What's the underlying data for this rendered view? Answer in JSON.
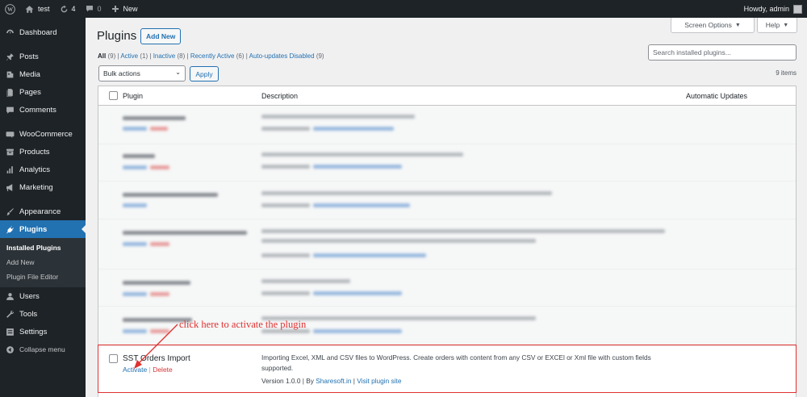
{
  "admin_bar": {
    "site_name": "test",
    "updates_count": "4",
    "comments_count": "0",
    "new_label": "New",
    "howdy": "Howdy, admin"
  },
  "sidebar": {
    "items": [
      {
        "label": "Dashboard",
        "icon": "dashboard-icon"
      },
      {
        "label": "Posts",
        "icon": "pin-icon"
      },
      {
        "label": "Media",
        "icon": "media-icon"
      },
      {
        "label": "Pages",
        "icon": "page-icon"
      },
      {
        "label": "Comments",
        "icon": "comment-icon"
      },
      {
        "label": "WooCommerce",
        "icon": "woo-icon"
      },
      {
        "label": "Products",
        "icon": "archive-icon"
      },
      {
        "label": "Analytics",
        "icon": "bar-chart-icon"
      },
      {
        "label": "Marketing",
        "icon": "megaphone-icon"
      },
      {
        "label": "Appearance",
        "icon": "brush-icon"
      },
      {
        "label": "Plugins",
        "icon": "plug-icon"
      },
      {
        "label": "Users",
        "icon": "user-icon"
      },
      {
        "label": "Tools",
        "icon": "wrench-icon"
      },
      {
        "label": "Settings",
        "icon": "settings-icon"
      },
      {
        "label": "Collapse menu",
        "icon": "collapse-icon"
      }
    ],
    "submenu": [
      "Installed Plugins",
      "Add New",
      "Plugin File Editor"
    ]
  },
  "page": {
    "title": "Plugins",
    "add_new": "Add New",
    "screen_options": "Screen Options",
    "help": "Help",
    "search_placeholder": "Search installed plugins...",
    "filters": {
      "all": "All",
      "all_count": "(9)",
      "active": "Active",
      "active_count": "(1)",
      "inactive": "Inactive",
      "inactive_count": "(8)",
      "recently_active": "Recently Active",
      "recently_active_count": "(6)",
      "auto_updates_disabled": "Auto-updates Disabled",
      "auto_updates_disabled_count": "(9)"
    },
    "bulk_actions": "Bulk actions",
    "apply": "Apply",
    "items_count": "9 items"
  },
  "table": {
    "columns": [
      "Plugin",
      "Description",
      "Automatic Updates"
    ],
    "plugin": {
      "name": "SST Orders Import",
      "activate": "Activate",
      "delete": "Delete",
      "description": "Importing Excel, XML and CSV files to WordPress. Create orders with content from any CSV or EXCEl or Xml file with custom fields supported.",
      "version": "Version 1.0.0",
      "by": "By",
      "author": "Sharesoft.in",
      "visit": "Visit plugin site"
    }
  },
  "annotation": {
    "text": "click here to activate the plugin",
    "color": "#e03131"
  }
}
